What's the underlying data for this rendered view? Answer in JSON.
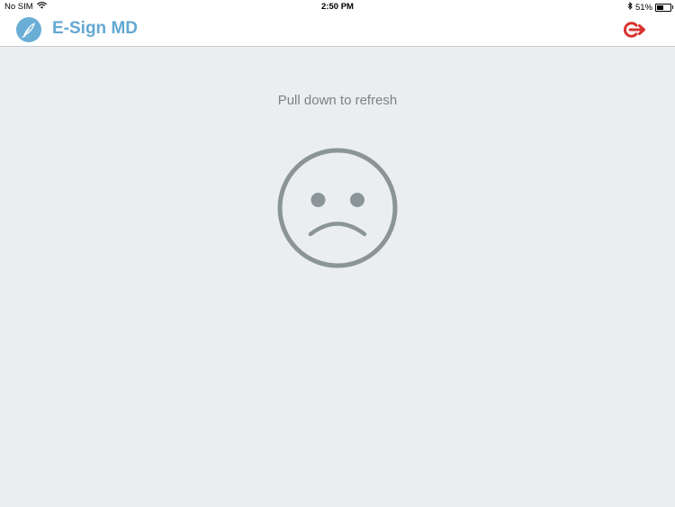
{
  "status_bar": {
    "carrier": "No SIM",
    "time": "2:50 PM",
    "battery_percent": "51%",
    "battery_level": 0.51,
    "icons": [
      "wifi-icon",
      "bluetooth-icon",
      "battery-icon"
    ]
  },
  "header": {
    "title": "E-Sign MD",
    "logo_icon": "pen-nib-icon",
    "logout_icon": "logout-icon"
  },
  "main": {
    "refresh_hint": "Pull down to refresh",
    "empty_state_icon": "sad-face-icon"
  },
  "colors": {
    "brand": "#63a8d3",
    "logout": "#d8312c",
    "background": "#ebeef0",
    "muted_text": "#7b8286",
    "face": "#8b9496"
  }
}
